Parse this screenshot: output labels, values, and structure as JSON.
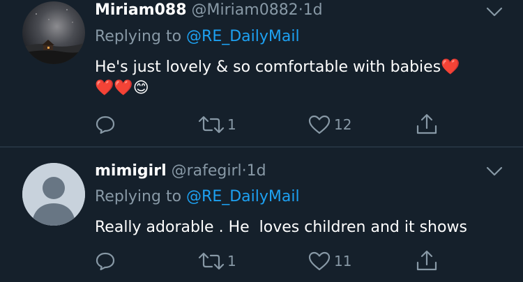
{
  "tweets": [
    {
      "display_name": "Miriam088",
      "handle": "@Miriam0882",
      "dot": "·",
      "time": "1d",
      "replying_prefix": "Replying to",
      "replying_to": "@RE_DailyMail",
      "text_line1": "He's just lovely & so comfortable with babies",
      "emoji_line1_end": "❤️",
      "emoji_line2": "❤️❤️😊",
      "reply_count": "",
      "retweet_count": "1",
      "like_count": "12",
      "avatar": "night-sky-photo"
    },
    {
      "display_name": "mimigirl",
      "handle": "@rafegirl",
      "dot": "·",
      "time": "1d",
      "replying_prefix": "Replying to",
      "replying_to": "@RE_DailyMail",
      "text_line1": "Really adorable . He  loves children and it shows",
      "reply_count": "",
      "retweet_count": "1",
      "like_count": "11",
      "avatar": "default-profile-silhouette"
    }
  ],
  "icons": {
    "reply": "reply-icon",
    "retweet": "retweet-icon",
    "like": "heart-icon",
    "share": "share-icon",
    "more": "chevron-down-icon"
  },
  "colors": {
    "background": "#15202b",
    "muted": "#8899a6",
    "link": "#1da1f2",
    "divider": "#253341",
    "text": "#ffffff"
  }
}
